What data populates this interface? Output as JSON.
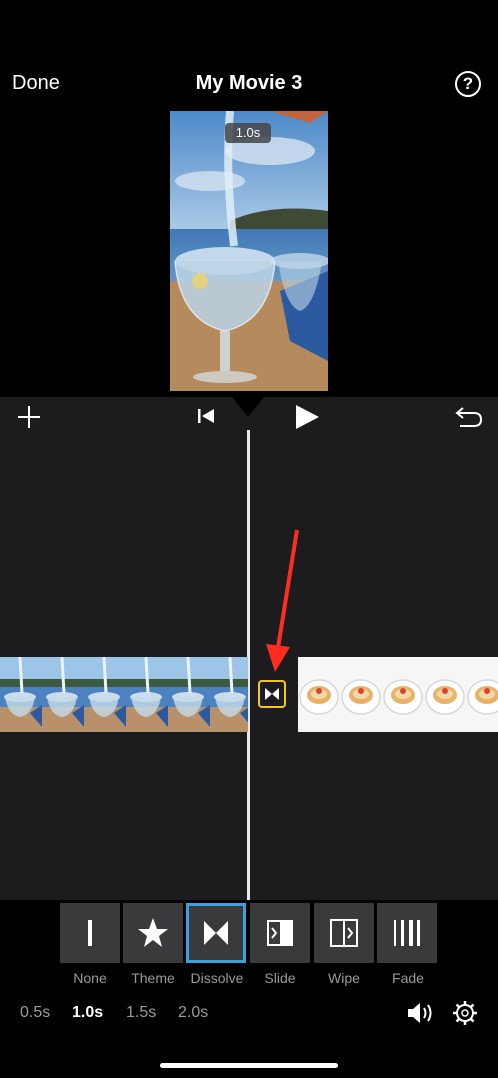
{
  "header": {
    "done_label": "Done",
    "title": "My Movie 3",
    "help_label": "?"
  },
  "preview": {
    "duration_badge": "1.0s"
  },
  "toolbar": {
    "add_icon": "plus-icon",
    "skip_back_icon": "skip-back-icon",
    "play_icon": "play-icon",
    "undo_icon": "undo-icon"
  },
  "timeline": {
    "clip_1_icon": "water-glass-clip-thumbnails",
    "clip_2_icon": "pastry-plate-clip-thumbnails",
    "transition_icon": "dissolve-transition-icon",
    "marker_color": "#f5c518",
    "arrow_color": "#ff2d20"
  },
  "transitions": {
    "items": [
      {
        "label": "None",
        "icon": "none-icon"
      },
      {
        "label": "Theme",
        "icon": "star-icon"
      },
      {
        "label": "Dissolve",
        "icon": "dissolve-icon",
        "selected": true
      },
      {
        "label": "Slide",
        "icon": "slide-icon"
      },
      {
        "label": "Wipe",
        "icon": "wipe-icon"
      },
      {
        "label": "Fade",
        "icon": "fade-icon"
      }
    ],
    "selected_color": "#3aa0de"
  },
  "durations": {
    "options": [
      "0.5s",
      "1.0s",
      "1.5s",
      "2.0s"
    ],
    "selected": "1.0s"
  },
  "bottom": {
    "volume_icon": "volume-icon",
    "settings_icon": "gear-icon"
  }
}
